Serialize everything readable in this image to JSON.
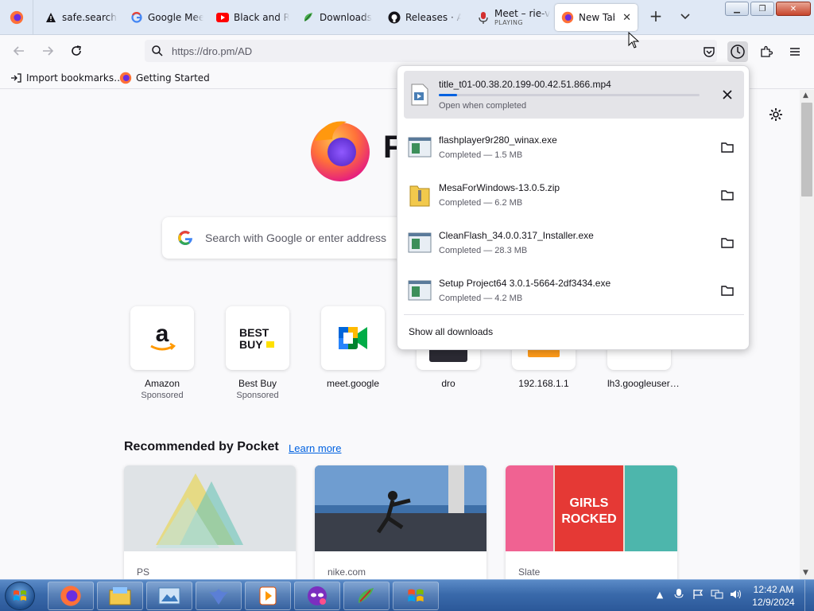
{
  "tabs": [
    {
      "title": "safe.search.t",
      "icon": "warning-icon"
    },
    {
      "title": "Google Meet",
      "icon": "google-icon"
    },
    {
      "title": "Black and Re",
      "icon": "youtube-icon"
    },
    {
      "title": "Downloads",
      "icon": "downloads-icon"
    },
    {
      "title": "Releases · A",
      "icon": "github-icon"
    },
    {
      "title": "Meet – rie-v",
      "subtitle": "PLAYING",
      "icon": "microphone-icon"
    },
    {
      "title": "New Tab",
      "icon": "firefox-icon",
      "active": true
    }
  ],
  "urlbar": {
    "value": "https://dro.pm/AD"
  },
  "bookmarks": [
    {
      "label": "Import bookmarks…",
      "icon": "import-icon"
    },
    {
      "label": "Getting Started",
      "icon": "firefox-icon"
    }
  ],
  "newtab": {
    "search_placeholder": "Search with Google or enter address",
    "tiles": [
      {
        "label": "Amazon",
        "sponsored": "Sponsored"
      },
      {
        "label": "Best Buy",
        "sponsored": "Sponsored"
      },
      {
        "label": "meet.google",
        "sponsored": ""
      },
      {
        "label": "dro",
        "sponsored": ""
      },
      {
        "label": "192.168.1.1",
        "sponsored": ""
      },
      {
        "label": "lh3.googleuser…",
        "sponsored": ""
      }
    ],
    "pocket_title": "Recommended by Pocket",
    "pocket_learn_more": "Learn more",
    "cards": [
      {
        "source": "PS"
      },
      {
        "source": "nike.com"
      },
      {
        "source": "Slate"
      }
    ]
  },
  "downloads": {
    "items": [
      {
        "name": "title_t01-00.38.20.199-00.42.51.866.mp4",
        "status": "Open when completed",
        "progress": 0.07,
        "in_progress": true,
        "icon": "video-file-icon"
      },
      {
        "name": "flashplayer9r280_winax.exe",
        "status": "Completed — 1.5 MB",
        "icon": "exe-file-icon"
      },
      {
        "name": "MesaForWindows-13.0.5.zip",
        "status": "Completed — 6.2 MB",
        "icon": "zip-file-icon"
      },
      {
        "name": "CleanFlash_34.0.0.317_Installer.exe",
        "status": "Completed — 28.3 MB",
        "icon": "exe-file-icon"
      },
      {
        "name": "Setup Project64 3.0.1-5664-2df3434.exe",
        "status": "Completed — 4.2 MB",
        "icon": "exe-file-icon"
      }
    ],
    "show_all": "Show all downloads"
  },
  "taskbar": {
    "apps": [
      "firefox-icon",
      "explorer-icon",
      "media-icon",
      "bird-icon",
      "vlc-icon",
      "mask-icon",
      "paint-icon",
      "windows-flag-icon"
    ],
    "time": "12:42 AM",
    "date": "12/9/2024"
  },
  "colors": {
    "accent": "#0061e0",
    "taskbar": "#3a6aab"
  }
}
